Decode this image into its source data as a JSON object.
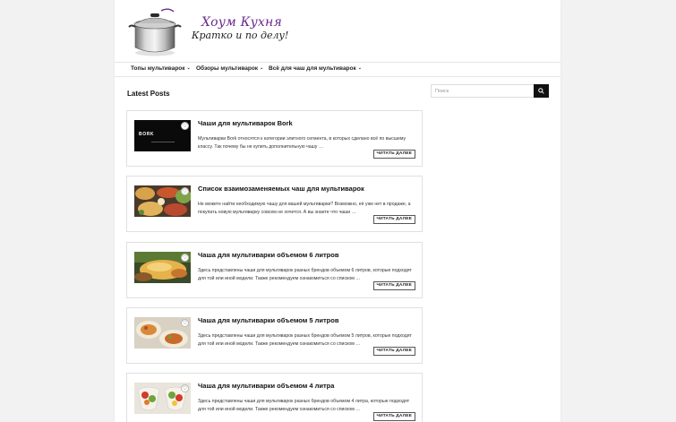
{
  "site": {
    "name": "Хоум Кухня",
    "tagline": "Кратко и по делу!"
  },
  "nav": {
    "items": [
      {
        "label": "Топы мультиварок"
      },
      {
        "label": "Обзоры мультиварок"
      },
      {
        "label": "Всё для чаш для мультиварок"
      }
    ]
  },
  "main": {
    "section_title": "Latest Posts"
  },
  "search": {
    "placeholder": "Поиск"
  },
  "posts": [
    {
      "title": "Чаши для мультиварок Bork",
      "excerpt": "Мультиварки Bork относятся к категории элитного сегмента, в которых сделано всё по высшему классу. Так почему бы не купить дополнительную чашу …",
      "read_more": "ЧИТАТЬ ДАЛЕЕ",
      "thumb_label": "BORK"
    },
    {
      "title": "Список взаимозаменяемых чаш для мультиварок",
      "excerpt": "Не можете найти необходимую чашу для вашей мультиварки? Возможно, её уже нет в продаже, а покупать новую мультиварку совсем не хочется. А вы знаете что чаши …",
      "read_more": "ЧИТАТЬ ДАЛЕЕ"
    },
    {
      "title": "Чаша для мультиварки объемом 6 литров",
      "excerpt": "Здесь представлены чаши для мультиварок разных брендов объемом 6 литров, которые подходят для той или иной модели. Также рекомендуем ознакомиться со списком …",
      "read_more": "ЧИТАТЬ ДАЛЕЕ"
    },
    {
      "title": "Чаша для мультиварки объемом 5 литров",
      "excerpt": "Здесь представлены чаши для мультиварок разных брендов объемом 5 литров, которые подходят для той или иной модели. Также рекомендуем ознакомиться со списком …",
      "read_more": "ЧИТАТЬ ДАЛЕЕ"
    },
    {
      "title": "Чаша для мультиварки объемом 4 литра",
      "excerpt": "Здесь представлены чаши для мультиварок разных брендов объемом 4 литра, которые подходят для той или иной модели. Также рекомендуем ознакомиться со списком …",
      "read_more": "ЧИТАТЬ ДАЛЕЕ"
    }
  ],
  "icons": {
    "heart": "heart-icon",
    "search": "search-icon",
    "chevron": "chevron-down-icon"
  },
  "colors": {
    "brand_purple": "#6a2a8e",
    "search_button": "#111111"
  }
}
